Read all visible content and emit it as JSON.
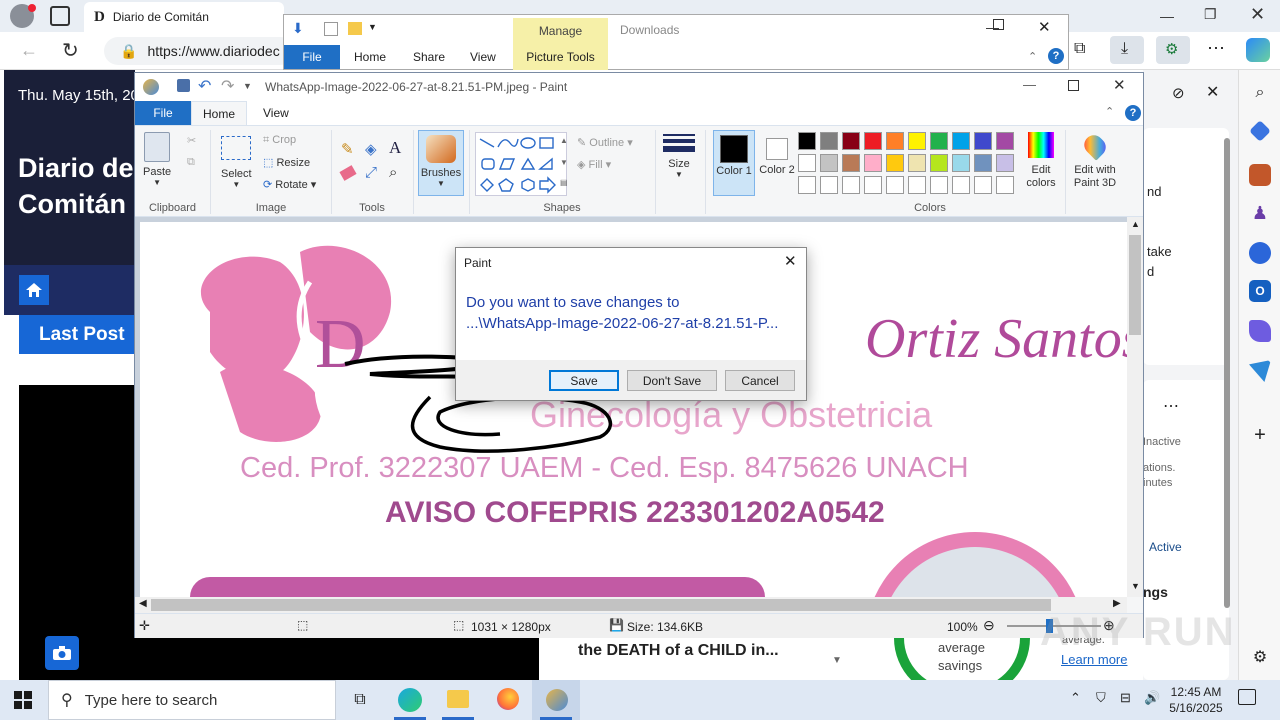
{
  "browser": {
    "tab_title": "Diario de Comitán",
    "tab_logo": "D",
    "url": "https://www.diariodec"
  },
  "site": {
    "date": "Thu. May 15th, 20",
    "title_line1": "Diario de",
    "title_line2": "Comitán",
    "last_post": "Last Post",
    "article_title": "the DEATH of a CHILD in...",
    "savings_line1": "average",
    "savings_line2": "savings",
    "average_text": "average.",
    "learn_more": "Learn more"
  },
  "right_panel": {
    "snippet1": "nd",
    "snippet2": "take",
    "snippet3": "d",
    "inactive": "Inactive",
    "ations": "ations.",
    "minutes": "inutes",
    "active": "Active",
    "ngs": "ngs"
  },
  "explorer": {
    "title": "Downloads",
    "tabs": [
      "File",
      "Home",
      "Share",
      "View"
    ],
    "manage": "Manage",
    "picture_tools": "Picture Tools"
  },
  "paint": {
    "title": "WhatsApp-Image-2022-06-27-at-8.21.51-PM.jpeg - Paint",
    "tabs": [
      "File",
      "Home",
      "View"
    ],
    "clipboard": {
      "paste": "Paste",
      "label": "Clipboard"
    },
    "image": {
      "select": "Select",
      "crop": "Crop",
      "resize": "Resize",
      "rotate": "Rotate",
      "label": "Image"
    },
    "tools_label": "Tools",
    "brushes": "Brushes",
    "shapes": {
      "outline": "Outline",
      "fill": "Fill",
      "label": "Shapes"
    },
    "size": "Size",
    "color1": "Color 1",
    "color2": "Color 2",
    "colors_label": "Colors",
    "edit_colors": "Edit colors",
    "edit_3d": "Edit with Paint 3D",
    "palette_row1": [
      "#000000",
      "#7f7f7f",
      "#880015",
      "#ed1c24",
      "#ff7f27",
      "#fff200",
      "#22b14c",
      "#00a2e8",
      "#3f48cc",
      "#a349a4"
    ],
    "palette_row2": [
      "#ffffff",
      "#c3c3c3",
      "#b97a57",
      "#ffaec9",
      "#ffc90e",
      "#efe4b0",
      "#b5e61d",
      "#99d9ea",
      "#7092be",
      "#c8bfe7"
    ],
    "status": {
      "dimensions": "1031 × 1280px",
      "size": "Size: 134.6KB",
      "zoom": "100%"
    }
  },
  "image_content": {
    "name_fragment_left": "D",
    "name_fragment_right": "Ortiz Santos",
    "specialty": "Ginecología y Obstetricia",
    "ced_line": "Ced. Prof. 3222307 UAEM - Ced. Esp. 8475626 UNACH",
    "aviso": "AVISO COFEPRIS 223301202A0542"
  },
  "dialog": {
    "title": "Paint",
    "line1": "Do you want to save changes to",
    "line2": "...\\WhatsApp-Image-2022-06-27-at-8.21.51-P...",
    "save": "Save",
    "dont_save": "Don't Save",
    "cancel": "Cancel"
  },
  "taskbar": {
    "search_placeholder": "Type here to search",
    "time": "12:45 AM",
    "date": "5/16/2025"
  },
  "watermark": "ANY RUN"
}
